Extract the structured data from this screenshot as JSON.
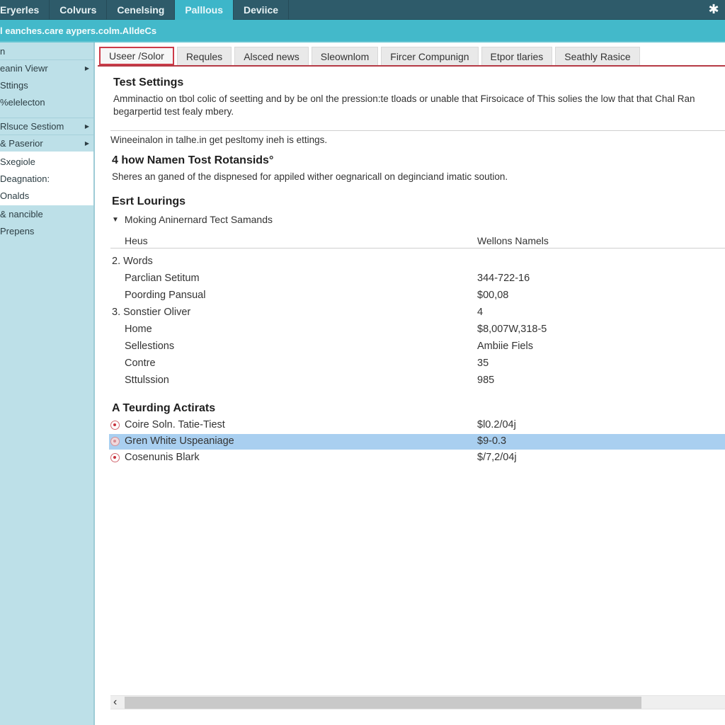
{
  "top_tabs": [
    {
      "label": "Eryerles",
      "active": false
    },
    {
      "label": "Colvurs",
      "active": false
    },
    {
      "label": "Cenelsing",
      "active": false
    },
    {
      "label": "Palllous",
      "active": true
    },
    {
      "label": "Deviice",
      "active": false
    }
  ],
  "top_icon": "asterisk-settings-icon",
  "address": {
    "url": "l eanches.care aypers.colm.AlldeCs"
  },
  "sidebar": {
    "items": [
      {
        "label": "n",
        "arrow": false
      },
      {
        "label": "eanin Viewr",
        "arrow": true
      },
      {
        "label": "Sttings",
        "arrow": false
      },
      {
        "label": "%elelecton",
        "arrow": false
      },
      {
        "label": "Rlsuce Sestiom",
        "arrow": true
      },
      {
        "label": "& Paserior",
        "arrow": true
      },
      {
        "label": "Sxegiole",
        "arrow": false
      },
      {
        "label": "Deagnation:",
        "arrow": false
      },
      {
        "label": "Onalds",
        "arrow": false
      },
      {
        "label": "& nancible",
        "arrow": false
      },
      {
        "label": "Prepens",
        "arrow": false
      }
    ]
  },
  "content_tabs": [
    {
      "label": "Useer /Solor",
      "active": true
    },
    {
      "label": "Requles",
      "active": false
    },
    {
      "label": "Alsced news",
      "active": false
    },
    {
      "label": "Sleownlom",
      "active": false
    },
    {
      "label": "Fircer Compunign",
      "active": false
    },
    {
      "label": "Etpor tlaries",
      "active": false
    },
    {
      "label": "Seathly Rasice",
      "active": false
    }
  ],
  "main": {
    "title": "Test Settings",
    "desc_line1": "Amminactio on tbol colic of seetting and by be onl the pression:te tloads or unable that Firsoicace of This solies the low that that Chal Ran",
    "desc_line2": "begarpertid test fealy mbery.",
    "note": "Wineeinalon in talhe.in get pesltomy ineh is ettings.",
    "section2_title": "4 how Namen Tost Rotansids°",
    "section2_desc": "Sheres an ganed of the dispnesed for appiled wither oegnaricall on deginciand imatic soution.",
    "section3_title": "Esrt Lourings",
    "tree_label": "Moking Aninernard Tect Samands",
    "columns": {
      "left": "Heus",
      "right": "Wellons Namels"
    },
    "rows": [
      {
        "label": "2. Words",
        "value": "",
        "numbered": true
      },
      {
        "label": "Parclian Setitum",
        "value": "344-722-16",
        "numbered": false
      },
      {
        "label": "Poording Pansual",
        "value": "$00,08",
        "numbered": false
      },
      {
        "label": "3. Sonstier Oliver",
        "value": "4",
        "numbered": true
      },
      {
        "label": "Home",
        "value": "$8,007W,318-5",
        "numbered": false
      },
      {
        "label": "Sellestions",
        "value": "Ambiie Fiels",
        "numbered": false
      },
      {
        "label": "Contre",
        "value": "35",
        "numbered": false
      },
      {
        "label": "Sttulssion",
        "value": "985",
        "numbered": false
      }
    ],
    "section4_title": "A Teurding Actirats",
    "actions": [
      {
        "label": "Coire Soln. Tatie-Tiest",
        "value": "$l0.2/04j",
        "selected": false
      },
      {
        "label": "Gren White Uspeaniage",
        "value": "$9-0.3",
        "selected": true
      },
      {
        "label": "Cosenunis Blark",
        "value": "$/7,2/04j",
        "selected": false
      }
    ]
  },
  "colors": {
    "topbar": "#2e5b6a",
    "active_top_tab": "#3db6c9",
    "address_bar": "#43b9ca",
    "sidebar": "#bde0e8",
    "active_tab_border": "#cc3b48",
    "selected_row": "#a9cff0"
  }
}
